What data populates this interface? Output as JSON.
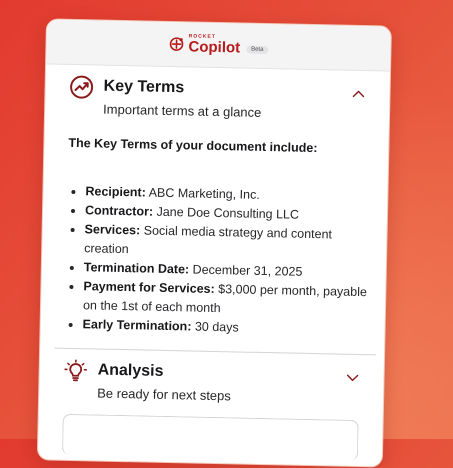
{
  "brand": {
    "small": "ROCKET",
    "name": "Copilot",
    "badge": "Beta"
  },
  "key_terms": {
    "title": "Key Terms",
    "subtitle": "Important terms at a glance",
    "intro": "The Key Terms of your document include:",
    "items": [
      {
        "label": "Recipient:",
        "value": "ABC Marketing, Inc."
      },
      {
        "label": "Contractor:",
        "value": "Jane Doe Consulting LLC"
      },
      {
        "label": "Services:",
        "value": "Social media strategy and content creation"
      },
      {
        "label": "Termination Date:",
        "value": "December 31, 2025"
      },
      {
        "label": "Payment for Services:",
        "value": "$3,000 per month, payable on the 1st of each month"
      },
      {
        "label": "Early Termination:",
        "value": "30 days"
      }
    ],
    "icon": "trend-chart-icon",
    "expanded": true
  },
  "analysis": {
    "title": "Analysis",
    "subtitle": "Be ready for next steps",
    "icon": "lightbulb-icon",
    "expanded": false
  },
  "colors": {
    "accent": "#b71c1c",
    "background_start": "#e23a2f",
    "background_end": "#ec6f4c"
  }
}
